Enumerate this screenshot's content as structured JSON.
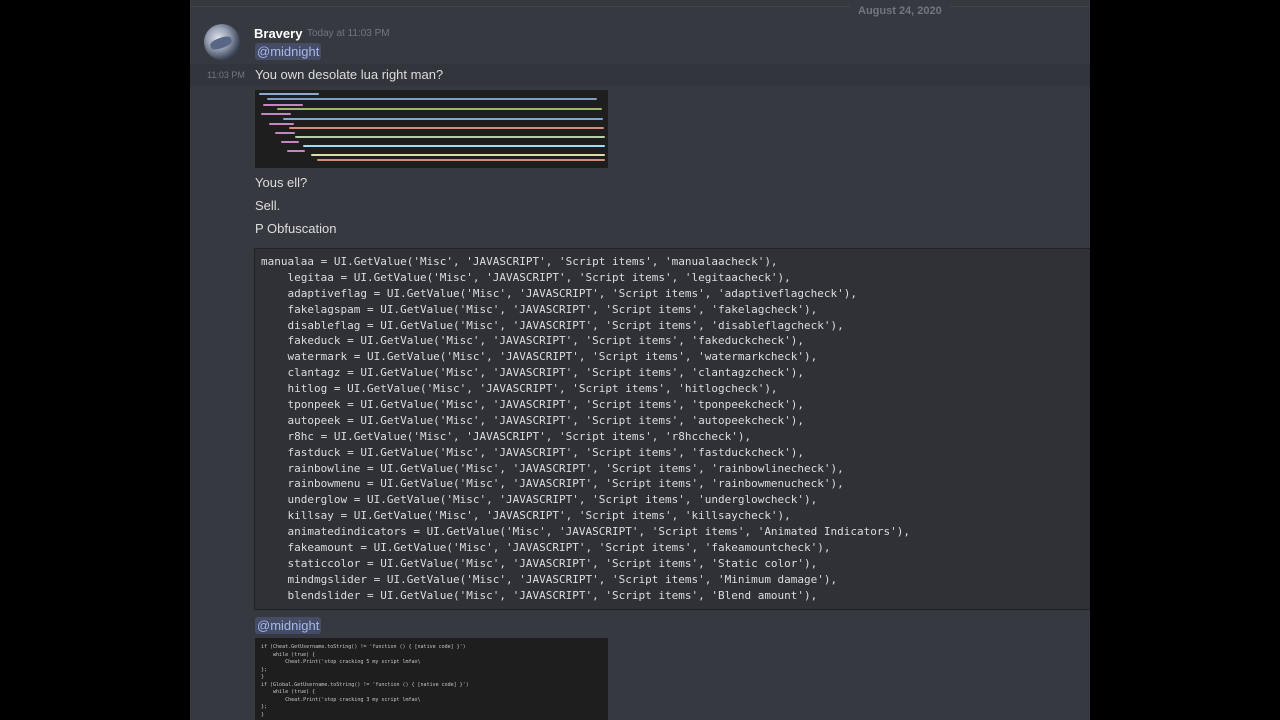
{
  "divider_date": "August 24, 2020",
  "message": {
    "author": "Bravery",
    "timestamp": "Today at 11:03 PM",
    "side_time": "11:03 PM",
    "mention1": "@midnight",
    "text1": "You own desolate lua right man?",
    "text2": "Yous ell?",
    "text3": "Sell.",
    "text4": "P Obfuscation",
    "mention2": "@midnight"
  },
  "code_lines": [
    "manualaa = UI.GetValue('Misc', 'JAVASCRIPT', 'Script items', 'manualaacheck'),",
    "    legitaa = UI.GetValue('Misc', 'JAVASCRIPT', 'Script items', 'legitaacheck'),",
    "    adaptiveflag = UI.GetValue('Misc', 'JAVASCRIPT', 'Script items', 'adaptiveflagcheck'),",
    "    fakelagspam = UI.GetValue('Misc', 'JAVASCRIPT', 'Script items', 'fakelagcheck'),",
    "    disableflag = UI.GetValue('Misc', 'JAVASCRIPT', 'Script items', 'disableflagcheck'),",
    "    fakeduck = UI.GetValue('Misc', 'JAVASCRIPT', 'Script items', 'fakeduckcheck'),",
    "    watermark = UI.GetValue('Misc', 'JAVASCRIPT', 'Script items', 'watermarkcheck'),",
    "    clantagz = UI.GetValue('Misc', 'JAVASCRIPT', 'Script items', 'clantagzcheck'),",
    "    hitlog = UI.GetValue('Misc', 'JAVASCRIPT', 'Script items', 'hitlogcheck'),",
    "    tponpeek = UI.GetValue('Misc', 'JAVASCRIPT', 'Script items', 'tponpeekcheck'),",
    "    autopeek = UI.GetValue('Misc', 'JAVASCRIPT', 'Script items', 'autopeekcheck'),",
    "    r8hc = UI.GetValue('Misc', 'JAVASCRIPT', 'Script items', 'r8hccheck'),",
    "    fastduck = UI.GetValue('Misc', 'JAVASCRIPT', 'Script items', 'fastduckcheck'),",
    "    rainbowline = UI.GetValue('Misc', 'JAVASCRIPT', 'Script items', 'rainbowlinecheck'),",
    "    rainbowmenu = UI.GetValue('Misc', 'JAVASCRIPT', 'Script items', 'rainbowmenucheck'),",
    "    underglow = UI.GetValue('Misc', 'JAVASCRIPT', 'Script items', 'underglowcheck'),",
    "    killsay = UI.GetValue('Misc', 'JAVASCRIPT', 'Script items', 'killsaycheck'),",
    "    animatedindicators = UI.GetValue('Misc', 'JAVASCRIPT', 'Script items', 'Animated Indicators'),",
    "    fakeamount = UI.GetValue('Misc', 'JAVASCRIPT', 'Script items', 'fakeamountcheck'),",
    "    staticcolor = UI.GetValue('Misc', 'JAVASCRIPT', 'Script items', 'Static color'),",
    "    mindmgslider = UI.GetValue('Misc', 'JAVASCRIPT', 'Script items', 'Minimum damage'),",
    "    blendslider = UI.GetValue('Misc', 'JAVASCRIPT', 'Script items', 'Blend amount'),"
  ],
  "image2_lines": [
    "if (Cheat.GetUsername.toString() != 'function () { [native code] }')",
    "    while (true) {",
    "        Cheat.Print('stop cracking 5 my script lmfao\\",
    "};",
    "}",
    "if (Global.GetUsername.toString() != 'function () { [native code] }')",
    "    while (true) {",
    "        Cheat.Print('stop cracking 3 my script lmfao\\",
    "};",
    "}"
  ]
}
